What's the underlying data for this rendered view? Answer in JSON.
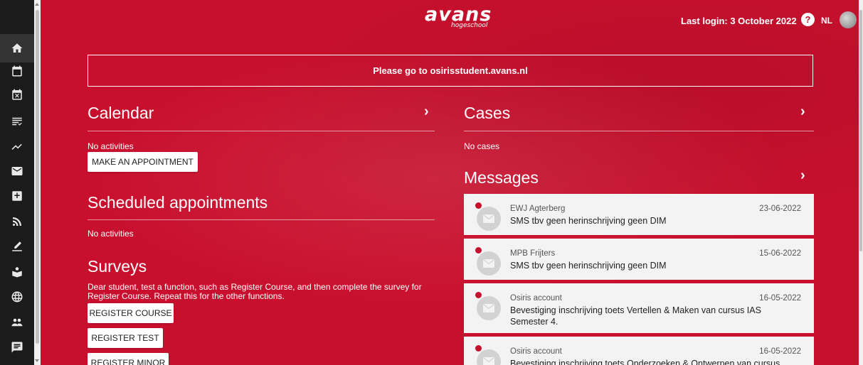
{
  "brand": {
    "logo": "avans",
    "logo_sub": "hogeschool"
  },
  "header": {
    "last_login": "Last login: 3 October 2022",
    "help": "?",
    "language": "NL"
  },
  "banner": {
    "text": "Please go to osirisstudent.avans.nl"
  },
  "nav": [
    {
      "name": "home-icon",
      "active": true
    },
    {
      "name": "calendar-icon"
    },
    {
      "name": "calendar-cancel-icon"
    },
    {
      "name": "list-check-icon"
    },
    {
      "name": "progress-chart-icon"
    },
    {
      "name": "mail-icon"
    },
    {
      "name": "inbox-add-icon"
    },
    {
      "name": "rss-icon"
    },
    {
      "name": "edit-pen-icon"
    },
    {
      "name": "school-icon"
    },
    {
      "name": "globe-icon"
    },
    {
      "name": "group-icon"
    },
    {
      "name": "chat-icon"
    }
  ],
  "calendar": {
    "title": "Calendar",
    "chevron": "›",
    "empty": "No activities",
    "button": "MAKE AN APPOINTMENT"
  },
  "appointments": {
    "title": "Scheduled appointments",
    "empty": "No activities"
  },
  "surveys": {
    "title": "Surveys",
    "description": "Dear student, test a function, such as Register Course, and then complete the survey for Register Course. Repeat this for the other functions.",
    "buttons": [
      "REGISTER COURSE",
      "REGISTER TEST",
      "REGISTER MINOR"
    ]
  },
  "cases": {
    "title": "Cases",
    "chevron": "›",
    "empty": "No cases"
  },
  "messages": {
    "title": "Messages",
    "chevron": "›",
    "items": [
      {
        "sender": "EWJ Agterberg",
        "date": "23-06-2022",
        "subject": "SMS tbv geen herinschrijving geen DIM"
      },
      {
        "sender": "MPB Frijters",
        "date": "15-06-2022",
        "subject": "SMS tbv geen herinschrijving geen DIM"
      },
      {
        "sender": "Osiris account",
        "date": "16-05-2022",
        "subject": "Bevestiging inschrijving toets Vertellen & Maken van cursus IAS Semester 4."
      },
      {
        "sender": "Osiris account",
        "date": "16-05-2022",
        "subject": "Bevestiging inschrijving toets Onderzoeken & Ontwerpen van cursus"
      }
    ]
  },
  "colors": {
    "brand_red": "#c8102e",
    "rail": "#1b1b1b"
  }
}
